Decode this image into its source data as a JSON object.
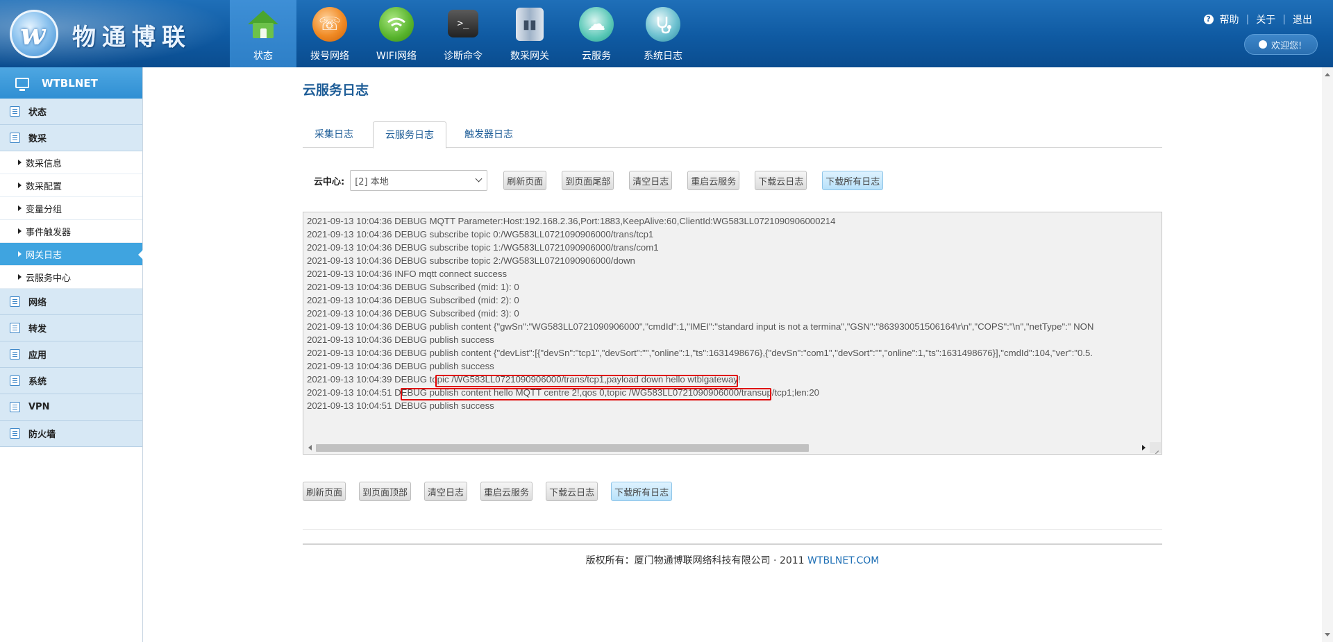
{
  "brand": {
    "logo_letter": "w",
    "name": "物通博联"
  },
  "topnav": [
    {
      "label": "状态",
      "icon": "home-icon",
      "active": true
    },
    {
      "label": "拨号网络",
      "icon": "dial-icon",
      "active": false
    },
    {
      "label": "WIFI网络",
      "icon": "wifi-icon",
      "active": false
    },
    {
      "label": "诊断命令",
      "icon": "terminal-icon",
      "active": false
    },
    {
      "label": "数采网关",
      "icon": "gateway-icon",
      "active": false
    },
    {
      "label": "云服务",
      "icon": "cloud-icon",
      "active": false
    },
    {
      "label": "系统日志",
      "icon": "stethoscope-icon",
      "active": false
    }
  ],
  "top_links": {
    "help": "帮助",
    "about": "关于",
    "logout": "退出",
    "help_glyph": "?"
  },
  "welcome": "欢迎您!",
  "sidebar": {
    "title": "WTBLNET",
    "groups": {
      "status": "状态",
      "collect": "数采",
      "network": "网络",
      "forward": "转发",
      "app": "应用",
      "system": "系统",
      "vpn": "VPN",
      "firewall": "防火墙"
    },
    "collect_items": [
      "数采信息",
      "数采配置",
      "变量分组",
      "事件触发器",
      "网关日志",
      "云服务中心"
    ],
    "active_item": "网关日志"
  },
  "main": {
    "title": "云服务日志",
    "tabs": [
      "采集日志",
      "云服务日志",
      "触发器日志"
    ],
    "active_tab": "云服务日志",
    "cloud_center_label": "云中心:",
    "cloud_center_value": "[2]  本地",
    "buttons_top": [
      "刷新页面",
      "到页面尾部",
      "清空日志",
      "重启云服务",
      "下载云日志",
      "下载所有日志"
    ],
    "buttons_bottom": [
      "刷新页面",
      "到页面顶部",
      "清空日志",
      "重启云服务",
      "下载云日志",
      "下载所有日志"
    ],
    "log_lines": [
      "2021-09-13 10:04:36 DEBUG MQTT Parameter:Host:192.168.2.36,Port:1883,KeepAlive:60,ClientId:WG583LL0721090906000214",
      "2021-09-13 10:04:36 DEBUG subscribe topic 0:/WG583LL0721090906000/trans/tcp1",
      "2021-09-13 10:04:36 DEBUG subscribe topic 1:/WG583LL0721090906000/trans/com1",
      "2021-09-13 10:04:36 DEBUG subscribe topic 2:/WG583LL0721090906000/down",
      "2021-09-13 10:04:36 INFO mqtt connect success",
      "2021-09-13 10:04:36 DEBUG Subscribed (mid: 1): 0",
      "2021-09-13 10:04:36 DEBUG Subscribed (mid: 2): 0",
      "2021-09-13 10:04:36 DEBUG Subscribed (mid: 3): 0",
      "2021-09-13 10:04:36 DEBUG publish content {\"gwSn\":\"WG583LL0721090906000\",\"cmdId\":1,\"IMEI\":\"standard input is not a termina\",\"GSN\":\"863930051506164\\r\\n\",\"COPS\":\"\\n\",\"netType\":\" NON",
      "2021-09-13 10:04:36 DEBUG publish success",
      "2021-09-13 10:04:36 DEBUG publish content {\"devList\":[{\"devSn\":\"tcp1\",\"devSort\":\"\",\"online\":1,\"ts\":1631498676},{\"devSn\":\"com1\",\"devSort\":\"\",\"online\":1,\"ts\":1631498676}],\"cmdId\":104,\"ver\":\"0.5.",
      "2021-09-13 10:04:36 DEBUG publish success",
      "2021-09-13 10:04:39 DEBUG topic /WG583LL0721090906000/trans/tcp1,payload down hello wtblgateway!",
      "2021-09-13 10:04:51 DEBUG publish content hello MQTT centre 2!,qos 0,topic /WG583LL0721090906000/transup/tcp1;len:20",
      "2021-09-13 10:04:51 DEBUG publish success"
    ]
  },
  "footer": {
    "text": "版权所有：厦门物通博联网络科技有限公司 · 2011",
    "link": "WTBLNET.COM"
  },
  "colors": {
    "header_bg": "#0f5aa2",
    "accent": "#3fa4e0",
    "title_blue": "#1e5d97",
    "highlight_red": "#e00000"
  }
}
